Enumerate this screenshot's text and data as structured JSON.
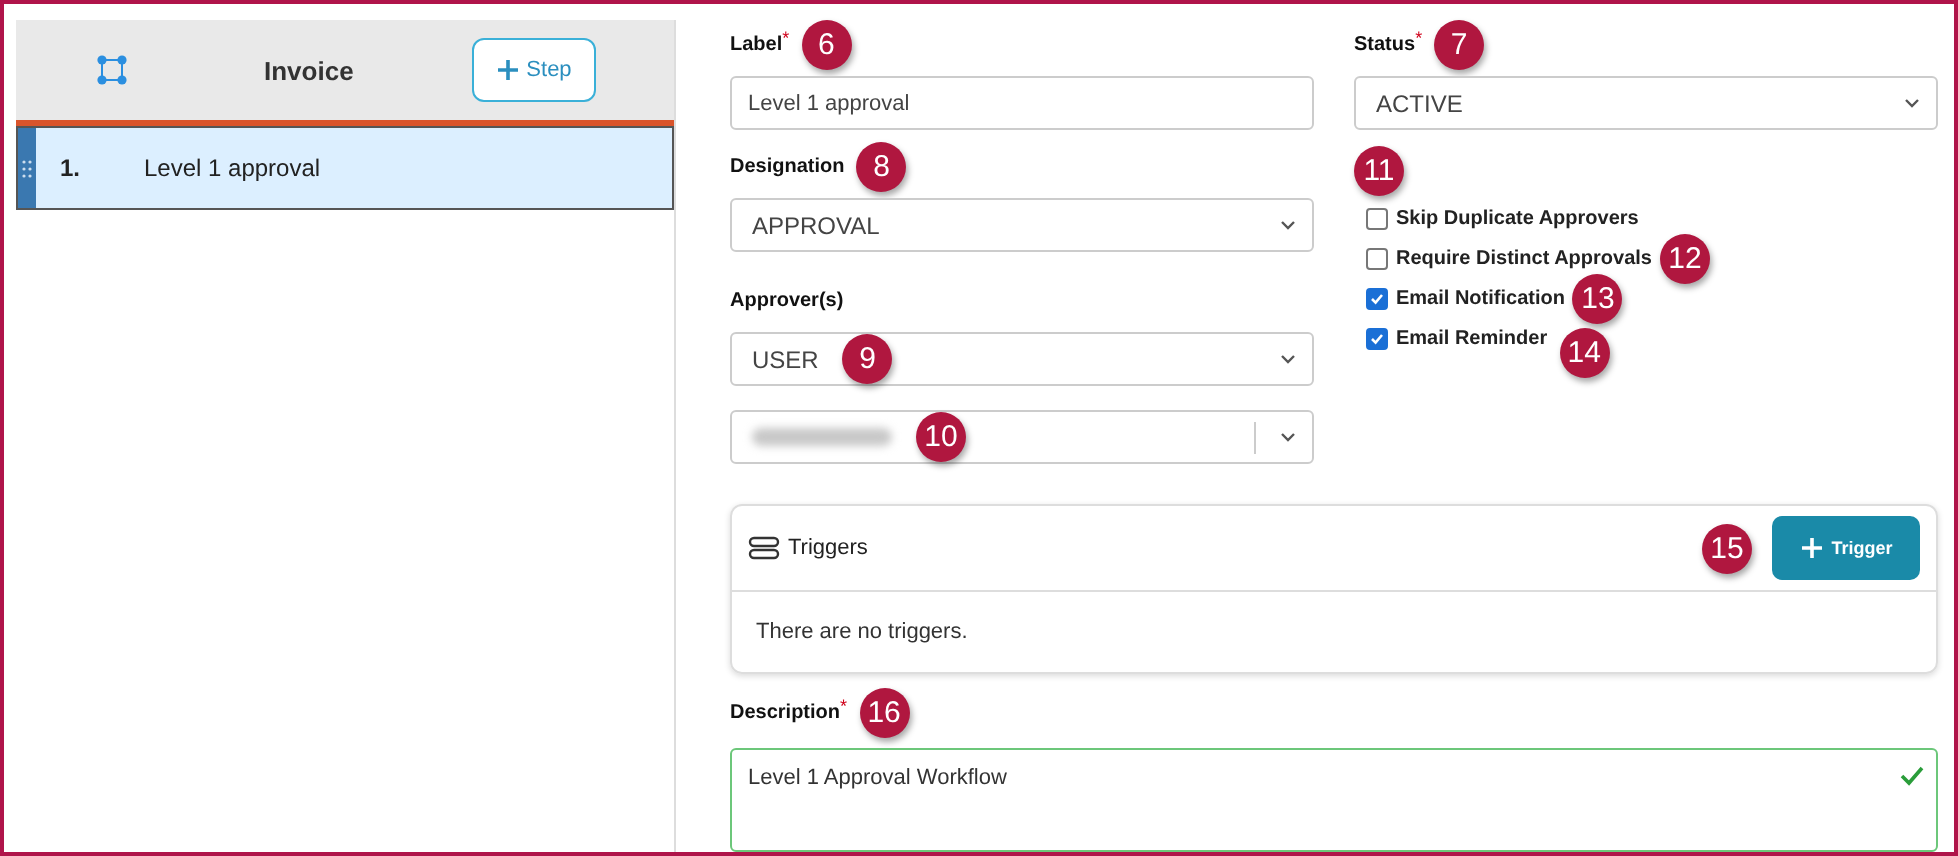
{
  "workflow": {
    "title": "Invoice",
    "add_step_button": "Step"
  },
  "steps": [
    {
      "number": "1.",
      "label": "Level 1 approval",
      "selected": true
    }
  ],
  "form": {
    "label": {
      "label": "Label",
      "required_mark": "*",
      "value": "Level 1 approval",
      "callout": "6"
    },
    "status": {
      "label": "Status",
      "required_mark": "*",
      "value": "ACTIVE",
      "callout": "7"
    },
    "designation": {
      "label": "Designation",
      "value": "APPROVAL",
      "callout": "8"
    },
    "approvers": {
      "label": "Approver(s)",
      "value": "USER",
      "select_callout": "9",
      "user_callout": "10"
    },
    "options_callout": "11",
    "options": [
      {
        "label": "Skip Duplicate Approvers",
        "checked": false
      },
      {
        "label": "Require Distinct Approvals",
        "checked": false,
        "callout": "12"
      },
      {
        "label": "Email Notification",
        "checked": true,
        "callout": "13"
      },
      {
        "label": "Email Reminder",
        "checked": true,
        "callout": "14"
      }
    ],
    "triggers": {
      "title": "Triggers",
      "add_button": "Trigger",
      "callout": "15",
      "empty_text": "There are no triggers."
    },
    "description": {
      "label": "Description",
      "required_mark": "*",
      "value": "Level 1 Approval Workflow",
      "valid": true,
      "callout": "16"
    }
  }
}
